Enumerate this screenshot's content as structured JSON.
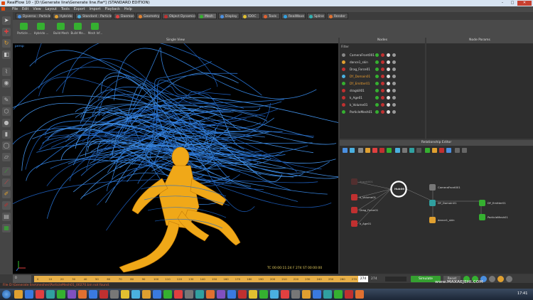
{
  "titlebar": {
    "title": "RealFlow 10 - [D:\\Generate line\\Generate line.flw*] (STANDARD EDITION)",
    "minimize": "–",
    "maximize": "□",
    "close": "✕"
  },
  "menu": [
    "File",
    "Edit",
    "View",
    "Layout",
    "Tools",
    "Export",
    "Import",
    "Playback",
    "Help"
  ],
  "tabs": [
    {
      "label": "Dyverso - Particles",
      "color": "#4a8fe0",
      "selected": false
    },
    {
      "label": "Hybrido",
      "color": "#e0a030",
      "selected": false
    },
    {
      "label": "Standard - Particles",
      "color": "#4ab0e0",
      "selected": false
    },
    {
      "label": "Daemons",
      "color": "#e04040",
      "selected": false
    },
    {
      "label": "Geometry",
      "color": "#e08030",
      "selected": false
    },
    {
      "label": "Object Dynamics",
      "color": "#c03030",
      "selected": false
    },
    {
      "label": "Mesh",
      "color": "#35b030",
      "selected": true
    },
    {
      "label": "Display",
      "color": "#4a8fe0",
      "selected": false
    },
    {
      "label": "IDOC",
      "color": "#e0c030",
      "selected": false
    },
    {
      "label": "Tools",
      "color": "#e06030",
      "selected": false
    },
    {
      "label": "RealWave",
      "color": "#30a0e0",
      "selected": false
    },
    {
      "label": "Spline",
      "color": "#30b0b0",
      "selected": false
    },
    {
      "label": "Render",
      "color": "#e07030",
      "selected": false
    }
  ],
  "shelf": [
    "Particle ...",
    "Hybrido ...",
    "Build Mesh",
    "Build Me...",
    "Mesh Inf..."
  ],
  "viewport": {
    "title": "Single View",
    "camera": "persp",
    "hud": "TC 00:00:11:24   F 274   ST 00:00:00"
  },
  "nodes": {
    "title": "Nodes",
    "filter": "Filter",
    "items": [
      {
        "label": "CameraFront001",
        "icon": "#888888",
        "highlight": false
      },
      {
        "label": "dance1_skin",
        "icon": "#e0a030",
        "highlight": false
      },
      {
        "label": "Drag_Force01",
        "icon": "#c03030",
        "highlight": false
      },
      {
        "label": "DY_Domain01",
        "icon": "#4ab0e0",
        "highlight": true
      },
      {
        "label": "DY_Emitter01",
        "icon": "#35b030",
        "highlight": true
      },
      {
        "label": "dragkill01",
        "icon": "#c03030",
        "highlight": false
      },
      {
        "label": "k_Age01",
        "icon": "#c03030",
        "highlight": false
      },
      {
        "label": "k_Volume01",
        "icon": "#c03030",
        "highlight": false
      },
      {
        "label": "ParticleMesh01",
        "icon": "#35b030",
        "highlight": false
      }
    ]
  },
  "params": {
    "title": "Node Params"
  },
  "relationship": {
    "title": "Relationship Editor",
    "hub": "Hub06",
    "nodes": [
      "dragkill01",
      "k_Volume01",
      "Drag_Force01",
      "k_Age01",
      "CameraFront001",
      "DY_Domain01",
      "DY_Emitter01",
      "dance1_skin",
      "ParticleMesh01"
    ]
  },
  "timeline": {
    "ticks": [
      "0",
      "10",
      "20",
      "30",
      "40",
      "50",
      "60",
      "70",
      "80",
      "90",
      "100",
      "110",
      "120",
      "130",
      "140",
      "150",
      "160",
      "170",
      "180",
      "190",
      "200",
      "210",
      "220",
      "230",
      "240",
      "250",
      "260",
      "270"
    ],
    "current_frame": "274",
    "end_frame": "274",
    "start": "0"
  },
  "sim": {
    "simulate": "Simulate",
    "reset": "Reset"
  },
  "status": "File D:\\Generate line\\meshes\\ParticleMesh01_00270.bin not found.",
  "taskbar": {
    "clock": "17:41",
    "watermark": "www.MAXAEJEHI.COM"
  }
}
